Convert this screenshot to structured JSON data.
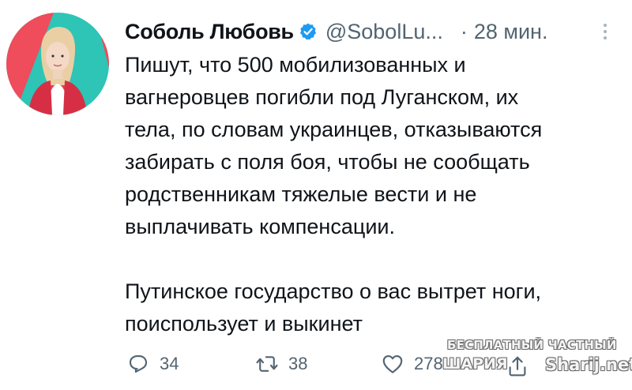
{
  "tweet": {
    "author_name": "Соболь Любовь",
    "handle": "@SobolLu...",
    "separator": "·",
    "time": "28 мин.",
    "text_paragraphs": [
      "Пишут, что 500 мобилизованных и\nвагнеровцев погибли под Луганском, их\nтела, по словам украинцев, отказываются\nзабирать с поля боя, чтобы не сообщать\nродственникам тяжелые вести и не\nвыплачивать компенсации.",
      "Путинское государство о вас вытрет ноги,\nпоиспользует и выкинет"
    ],
    "replies": "34",
    "retweets": "38",
    "likes": "278"
  },
  "icons": {
    "verified": "verified-badge-icon",
    "more": "more-dots-icon",
    "reply": "reply-icon",
    "retweet": "retweet-icon",
    "like": "heart-icon",
    "share": "share-icon"
  },
  "watermark": {
    "line1": "БЕСПЛАТНЫЙ ЧАСТНЫЙ",
    "line2": "ШАРИЯ",
    "line3": "Sharij.net"
  },
  "colors": {
    "text": "#0f1419",
    "secondary": "#536471",
    "verified": "#1d9bf0",
    "avatar_bg": "#2ec4b6",
    "avatar_accent": "#e8414f"
  }
}
